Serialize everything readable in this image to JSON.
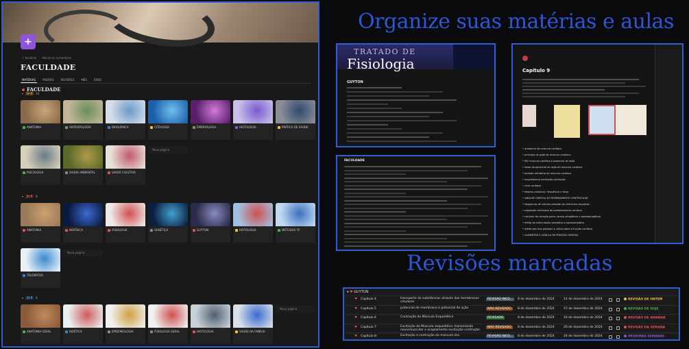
{
  "left_panel": {
    "meta": [
      "↑ backlink",
      "Adicionar comentário"
    ],
    "page_icon": "+",
    "title": "FACULDADE",
    "views": [
      "MATÉRIAS",
      "PADRÃO",
      "REVISÕES",
      "MÊS",
      "ERRO"
    ],
    "db_title": "FACULDADE",
    "groups": [
      {
        "tag": "1º P",
        "count": "10",
        "cards": [
          {
            "label": "ANATOMIA",
            "color": "#8a6a4a",
            "tone": "#c9a57a",
            "icon_color": "#4caf50"
          },
          {
            "label": "ANTROPOLOGIA",
            "color": "#c2b59a",
            "tone": "#6b8f5a",
            "icon_color": "#888"
          },
          {
            "label": "BIOQUÍMICA",
            "color": "#d5dde8",
            "tone": "#6a9ac9",
            "icon_color": "#3f7fd9"
          },
          {
            "label": "CITOLOGIA",
            "color": "#1d5fa8",
            "tone": "#6fc0f0",
            "icon_color": "#f0c040"
          },
          {
            "label": "EMBRIOLOGIA",
            "color": "#5a1f6a",
            "tone": "#d07ad9",
            "icon_color": "#888"
          },
          {
            "label": "HISTOLOGIA",
            "color": "#c9bfe8",
            "tone": "#7a5ad0",
            "icon_color": "#8f55d9"
          },
          {
            "label": "PRÁTICA DE SAÚDE",
            "color": "#8a8e96",
            "tone": "#2f4a70",
            "icon_color": "#f0c040"
          },
          {
            "label": "PSICOLOGIA",
            "color": "#d8d0b8",
            "tone": "#6a7a8a",
            "icon_color": "#4caf50"
          },
          {
            "label": "SAÚDE AMBIENTAL",
            "color": "#5a6a2a",
            "tone": "#b09a4a",
            "icon_color": "#888"
          },
          {
            "label": "SAÚDE COLETIVA",
            "color": "#e8e0d8",
            "tone": "#c05a6a",
            "icon_color": "#d9534f"
          }
        ],
        "new_page": "Nova página"
      },
      {
        "tag": "2º P",
        "count": "8",
        "cards": [
          {
            "label": "ANATOMIA",
            "color": "#9a7a5a",
            "tone": "#d0a070",
            "icon_color": "#d9534f"
          },
          {
            "label": "BIOFÍSICA",
            "color": "#0d1a40",
            "tone": "#3a6ad0",
            "icon_color": "#d9534f"
          },
          {
            "label": "FISIOLOGIA",
            "color": "#f0e8e8",
            "tone": "#d05050",
            "icon_color": "#d9534f"
          },
          {
            "label": "GENÉTICA",
            "color": "#0d2040",
            "tone": "#40a0d0",
            "icon_color": "#888"
          },
          {
            "label": "GUYTON",
            "color": "#2a2a4a",
            "tone": "#8a8ac0",
            "icon_color": "#d9534f"
          },
          {
            "label": "HISTOLOGIA",
            "color": "#a0c0e0",
            "tone": "#d05050",
            "icon_color": "#f0c040"
          },
          {
            "label": "MÉTODOS TP",
            "color": "#c0d8f0",
            "tone": "#3a70c0",
            "icon_color": "#4caf50"
          },
          {
            "label": "TELEMATOR",
            "color": "#e8f0f8",
            "tone": "#3a8ad0",
            "icon_color": "#3f7fd9"
          }
        ],
        "new_page": "Nova página"
      },
      {
        "tag": "3º P",
        "count": "6",
        "cards": [
          {
            "label": "ANATOMIA GERAL",
            "color": "#8a5a3a",
            "tone": "#c08a5a",
            "icon_color": "#4caf50"
          },
          {
            "label": "BIOÉTICA",
            "color": "#e8f0f0",
            "tone": "#d05a5a",
            "icon_color": "#3f7fd9"
          },
          {
            "label": "EPIDEMIOLOGIA",
            "color": "#f0f0f0",
            "tone": "#d0a040",
            "icon_color": "#888"
          },
          {
            "label": "FISIOLOGIA GERAL",
            "color": "#f0f0f0",
            "tone": "#d05050",
            "icon_color": "#888"
          },
          {
            "label": "HISTOLOGIA",
            "color": "#c8d0d8",
            "tone": "#506070",
            "icon_color": "#d9534f"
          },
          {
            "label": "SAÚDE DA FAMÍLIA",
            "color": "#d8e0e8",
            "tone": "#3a6ad0",
            "icon_color": "#f0c040"
          }
        ],
        "new_page": "Nova página"
      }
    ]
  },
  "headings": {
    "top": "Organize suas matérias e aulas",
    "bottom": "Revisões marcadas"
  },
  "shot1": {
    "hero_top": "TRATADO DE",
    "hero_main": "Fisiologia",
    "page_title": "GUYTON"
  },
  "shot2": {
    "db_title": "FACULDADE"
  },
  "shot3": {
    "chapter": "Capítulo 9",
    "bullets": [
      "anatomia do músculo cardíaco",
      "princípio da ação do músculo cardíaco",
      "fibr músculo cardíaco e potencial de ação",
      "fases do potencial de ação do músculo cardíaco",
      "período refratário do músculo cardíaco",
      "acoplamento excitação-contração",
      "ciclo cardíaco",
      "fatores cardíacos: frequência e força",
      "ANÁLISE GRÁFICA DO BOMBEAMENTO VENTRICULAR",
      "diagramas de volume-pressão do ventrículo esquerdo",
      "regulação intrínseca do bombeamento cardíaco",
      "controle do coração pelos nervos simpáticos e parassimpáticos",
      "efeito da estimulação simpática e parassimpática",
      "efeito dos íons potássio e cálcio sobre a função cardíaca",
      "ALIMENTAR A CÂNULA DE PRESSÃO VENOSA"
    ]
  },
  "review": {
    "group": "GUYTON",
    "rows": [
      {
        "cap": "Capítulo 4",
        "topic": "transporte de substâncias através das membranas celulares",
        "status": "REVISÃO INCO...",
        "status_color": "#4a5a6a",
        "date1": "8 de dezembro de 2024",
        "date2": "14 de dezembro de 2024",
        "due": "REVISÃO DE ONTEM",
        "due_color": "#f0c040"
      },
      {
        "cap": "Capítulo 5",
        "topic": "potencial de membrana e potencial de ação",
        "status": "NÃO REVISADO",
        "status_color": "#8a4a1a",
        "date1": "8 de dezembro de 2024",
        "date2": "15 de dezembro de 2024",
        "due": "REVISÃO DE HOJE",
        "due_color": "#4caf50"
      },
      {
        "cap": "Capítulo 6",
        "topic": "Contração do Músculo Esquelético",
        "status": "REVISADO",
        "status_color": "#2a6a3a",
        "date1": "8 de dezembro de 2024",
        "date2": "16 de dezembro de 2024",
        "due": "REVISÃO DE AMANHÃ",
        "due_color": "#e05555"
      },
      {
        "cap": "Capítulo 7",
        "topic": "Excitação do Músculo esquelético: transmissão neuromuscular e acoplamento excitação-contração",
        "status": "NÃO REVISADO",
        "status_color": "#8a4a1a",
        "date1": "8 de dezembro de 2024",
        "date2": "20 de dezembro de 2024",
        "due": "REVISÃO DA SEMANA",
        "due_color": "#e05555"
      },
      {
        "cap": "Capítulo 8",
        "topic": "Excitação e contração do músculo liso",
        "status": "REVISÃO INCO...",
        "status_color": "#4a5a6a",
        "date1": "8 de dezembro de 2024",
        "date2": "24 de dezembro de 2024",
        "due": "PRÓXIMAS SEMANAS",
        "due_color": "#8f55d9"
      }
    ]
  }
}
